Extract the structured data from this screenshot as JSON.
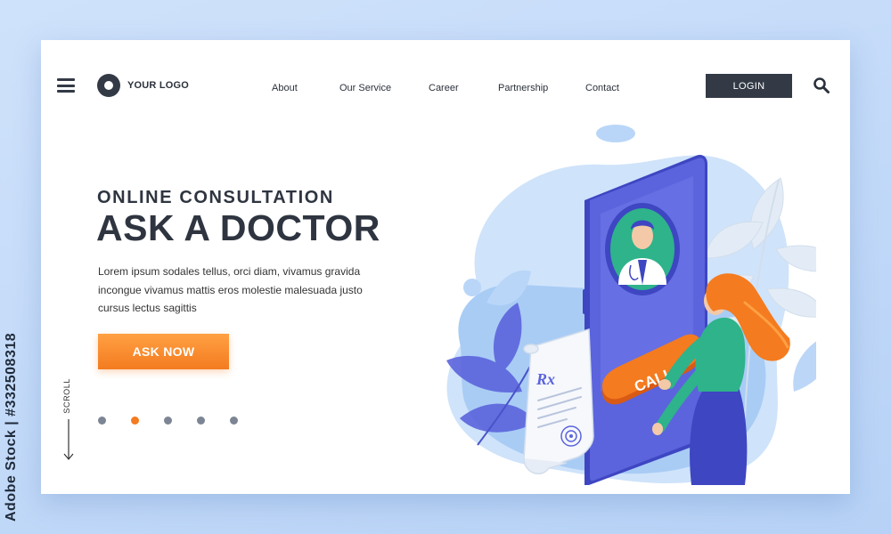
{
  "header": {
    "logo_text": "YOUR LOGO",
    "nav": [
      {
        "label": "About"
      },
      {
        "label": "Our Service"
      },
      {
        "label": "Career"
      },
      {
        "label": "Partnership"
      },
      {
        "label": "Contact"
      }
    ],
    "login_label": "LOGIN",
    "icons": {
      "menu": "hamburger-icon",
      "search": "search-icon",
      "logo": "ring-logo-icon"
    }
  },
  "hero": {
    "eyebrow": "ONLINE CONSULTATION",
    "title": "ASK A DOCTOR",
    "body": "Lorem ipsum sodales tellus, orci diam, vivamus gravida incongue vivamus mattis eros molestie malesuada justo cursus lectus sagittis",
    "cta_label": "ASK NOW"
  },
  "scroll": {
    "label": "SCROLL"
  },
  "pagination": {
    "count": 5,
    "active_index": 1
  },
  "illustration": {
    "call_label": "CALL",
    "rx_label": "Rx"
  },
  "stock_id": "Adobe Stock | #332508318",
  "colors": {
    "accent": "#f47b1f",
    "dark": "#333a46",
    "phone": "#5b64dc",
    "doctor_bg": "#2eb38b",
    "blob": "#a8ccf5"
  }
}
